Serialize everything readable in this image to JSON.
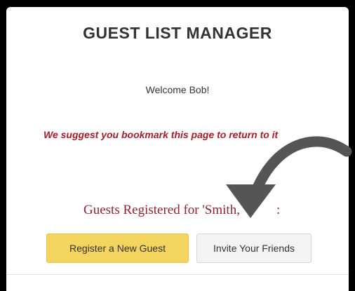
{
  "app": {
    "title": "GUEST LIST MANAGER"
  },
  "main": {
    "welcome_text": "Welcome Bob!",
    "bookmark_note": "We suggest you bookmark this page to return to it",
    "guests_heading": "Guests Registered for 'Smith,",
    "guests_heading_tail": ":"
  },
  "buttons": {
    "register_label": "Register a New Guest",
    "invite_label": "Invite Your Friends"
  },
  "annotation": {
    "icon": "curved-arrow-icon",
    "color": "#555555"
  },
  "colors": {
    "register_button": "#f2d45f",
    "invite_button": "#f3f3f3",
    "accent_red": "#a31d2a",
    "heading_red": "#8e2431"
  }
}
